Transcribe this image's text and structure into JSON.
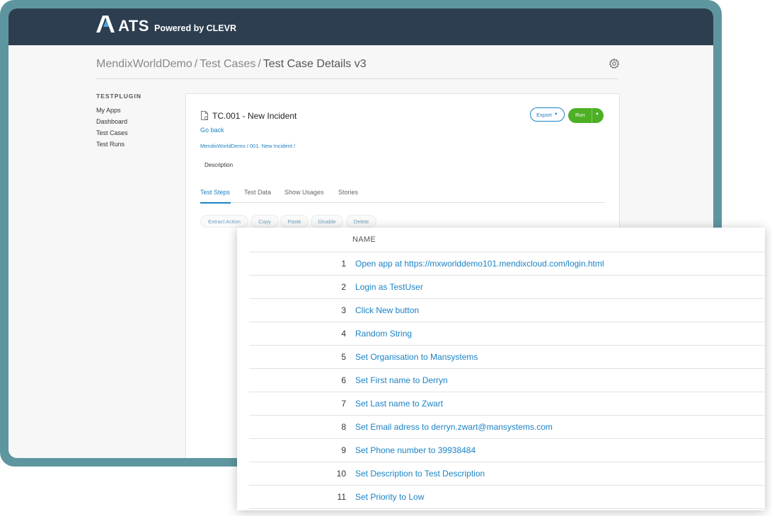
{
  "app": {
    "brand": "ATS",
    "powered_by": "Powered by CLEVR"
  },
  "breadcrumb": {
    "items": [
      "MendixWorldDemo",
      "Test Cases"
    ],
    "separator": "/",
    "current": "Test Case Details v3"
  },
  "sidebar": {
    "title": "TESTPLUGIN",
    "items": [
      {
        "label": "My Apps"
      },
      {
        "label": "Dashboard"
      },
      {
        "label": "Test Cases"
      },
      {
        "label": "Test Runs"
      }
    ]
  },
  "test_case": {
    "title": "TC.001 - New Incident",
    "go_back": "Go back",
    "path": "MendixWorldDemo / 001. New Incident /",
    "description_label": "Description"
  },
  "actions": {
    "export_label": "Export",
    "run_label": "Run"
  },
  "tabs": [
    {
      "label": "Test Steps",
      "active": true
    },
    {
      "label": "Test Data",
      "active": false
    },
    {
      "label": "Show Usages",
      "active": false
    },
    {
      "label": "Stories",
      "active": false
    }
  ],
  "toolbar": {
    "extract_action": "Extract Action",
    "copy": "Copy",
    "paste": "Paste",
    "disable": "Disable",
    "delete": "Delete"
  },
  "steps_table": {
    "header_name": "NAME",
    "rows": [
      {
        "num": "1",
        "name": "Open app at https://mxworlddemo101.mendixcloud.com/login.html"
      },
      {
        "num": "2",
        "name": "Login as TestUser"
      },
      {
        "num": "3",
        "name": "Click New button"
      },
      {
        "num": "4",
        "name": "Random String"
      },
      {
        "num": "5",
        "name": "Set Organisation to Mansystems"
      },
      {
        "num": "6",
        "name": "Set First name to Derryn"
      },
      {
        "num": "7",
        "name": "Set Last name to Zwart"
      },
      {
        "num": "8",
        "name": "Set Email adress to derryn.zwart@mansystems.com"
      },
      {
        "num": "9",
        "name": "Set Phone number to 39938484"
      },
      {
        "num": "10",
        "name": "Set Description to Test Description"
      },
      {
        "num": "11",
        "name": "Set Priority to Low"
      }
    ]
  },
  "colors": {
    "frame": "#5e969f",
    "topbar": "#2c3e4f",
    "link": "#1b83c4",
    "run_button": "#4caf24"
  },
  "icons": {
    "logo": "ats-logo-icon",
    "settings": "gear-icon",
    "test_case": "document-icon",
    "dropdown": "caret-down-icon"
  }
}
